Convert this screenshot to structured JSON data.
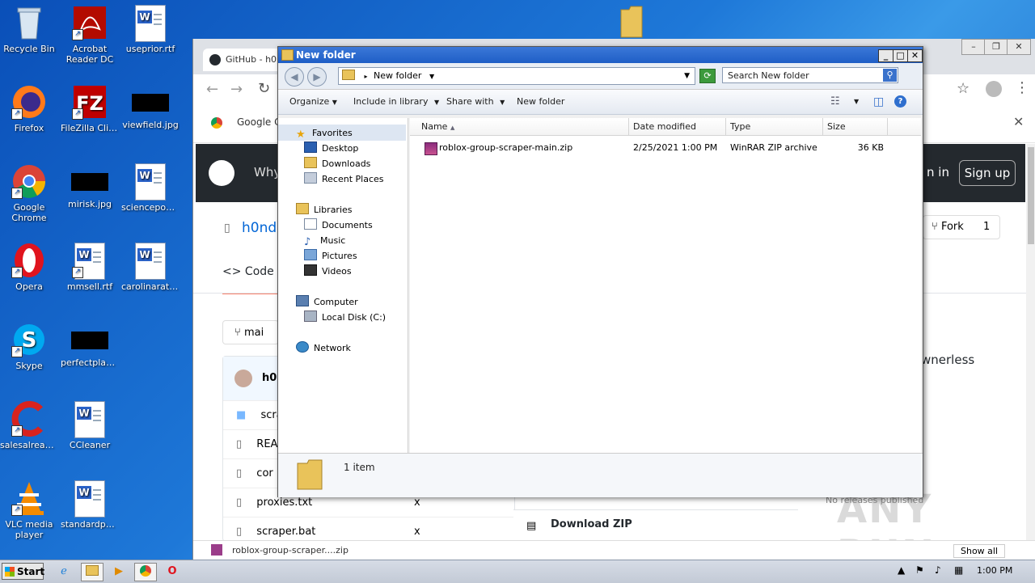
{
  "desktop": {
    "icons": [
      {
        "label": "Recycle Bin",
        "icon": "recycle-bin-icon"
      },
      {
        "label": "Acrobat Reader DC",
        "icon": "acrobat-icon"
      },
      {
        "label": "useprior.rtf",
        "icon": "word-doc-icon"
      },
      {
        "label": "Firefox",
        "icon": "firefox-icon"
      },
      {
        "label": "FileZilla Client",
        "icon": "filezilla-icon"
      },
      {
        "label": "viewfield.jpg",
        "icon": "image-file-icon"
      },
      {
        "label": "Google Chrome",
        "icon": "chrome-icon"
      },
      {
        "label": "mirisk.jpg",
        "icon": "image-file-icon"
      },
      {
        "label": "sciencepool.rtf",
        "icon": "word-doc-icon"
      },
      {
        "label": "Opera",
        "icon": "opera-icon"
      },
      {
        "label": "mmsell.rtf",
        "icon": "word-doc-icon"
      },
      {
        "label": "carolinarate...",
        "icon": "word-doc-icon"
      },
      {
        "label": "Skype",
        "icon": "skype-icon"
      },
      {
        "label": "perfectplac...",
        "icon": "image-file-icon"
      },
      {
        "label": "CCleaner",
        "icon": "ccleaner-icon"
      },
      {
        "label": "salesalread...",
        "icon": "word-doc-icon"
      },
      {
        "label": "VLC media player",
        "icon": "vlc-icon"
      },
      {
        "label": "standardpol...",
        "icon": "word-doc-icon"
      }
    ]
  },
  "browser": {
    "tab_title": "GitHub - h0r",
    "bookmark": "Google C",
    "gh_header_text": "Why",
    "sign_in": "n in",
    "sign_up": "Sign up",
    "repo_owner": "h0nd",
    "fork_label": "Fork",
    "fork_count": "1",
    "code_tab": "Code",
    "branch": "mai",
    "author": "h0r",
    "about_text": "wnerless",
    "files": [
      {
        "name": "scra"
      },
      {
        "name": "REA"
      },
      {
        "name": "cor"
      },
      {
        "name": "proxies.txt",
        "msg": "x"
      },
      {
        "name": "scraper.bat",
        "msg": "x"
      }
    ],
    "download_zip": "Download ZIP",
    "releases": "No releases published",
    "download_item": "roblox-group-scraper....zip",
    "show_all": "Show all",
    "watermark": "ANY RUN"
  },
  "explorer": {
    "title": "New folder",
    "breadcrumb": "New folder",
    "search_placeholder": "Search New folder",
    "commands": {
      "organize": "Organize",
      "include": "Include in library",
      "share": "Share with",
      "new_folder": "New folder"
    },
    "nav": {
      "favorites": "Favorites",
      "desktop": "Desktop",
      "downloads": "Downloads",
      "recent": "Recent Places",
      "libraries": "Libraries",
      "documents": "Documents",
      "music": "Music",
      "pictures": "Pictures",
      "videos": "Videos",
      "computer": "Computer",
      "local_disk": "Local Disk (C:)",
      "network": "Network"
    },
    "columns": {
      "name": "Name",
      "date": "Date modified",
      "type": "Type",
      "size": "Size"
    },
    "file": {
      "name": "roblox-group-scraper-main.zip",
      "date": "2/25/2021 1:00 PM",
      "type": "WinRAR ZIP archive",
      "size": "36 KB"
    },
    "status": "1 item"
  },
  "taskbar": {
    "start": "Start",
    "clock": "1:00 PM"
  }
}
